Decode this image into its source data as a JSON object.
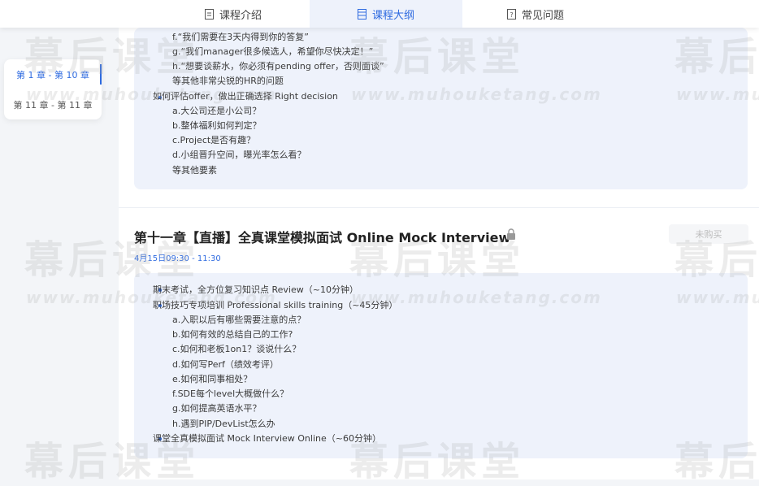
{
  "tabs": {
    "intro": "课程介绍",
    "outline": "课程大纲",
    "faq": "常见问题"
  },
  "chapter_nav": {
    "items": [
      "第 1 章 - 第 10 章",
      "第 11 章 - 第 11 章"
    ],
    "active_index": 0
  },
  "prev_chapter": {
    "lines": [
      "f.“我们需要在3天内得到你的答复”",
      "g.“我们manager很多候选人，希望你尽快决定！”",
      "h.“想要谈薪水，你必须有pending offer，否则面谈”",
      "等其他非常尖锐的HR的问题",
      "如何评估offer，做出正确选择 Right decision",
      "a.大公司还是小公司？",
      "b.整体福利如何判定？",
      "c.Project是否有趣？",
      "d.小组晋升空间，曝光率怎么看？",
      "等其他要素"
    ]
  },
  "chapter11": {
    "title": "第十一章【直播】全真课堂模拟面试 Online Mock Interview",
    "time": "4月15日09:30 - 11:30",
    "buy_label": "未购买",
    "lines": [
      "期末考试，全方位复习知识点 Review（~10分钟）",
      "职场技巧专项培训 Professional skills training（~45分钟）",
      "a.入职以后有哪些需要注意的点？",
      "b.如何有效的总结自己的工作?",
      "c.如何和老板1on1？谈说什么？",
      "d.如何写Perf（绩效考评）",
      "e.如何和同事相处？",
      "f.SDE每个level大概做什么？",
      "g.如何提高英语水平？",
      "h.遇到PIP/DevList怎么办",
      "课堂全真模拟面试 Mock Interview Online（~60分钟）"
    ]
  },
  "watermark": {
    "text": "幕后课堂",
    "url": "www.muhouketang.com"
  },
  "colors": {
    "accent": "#2f6be0",
    "box_bg": "#eef2fb"
  }
}
